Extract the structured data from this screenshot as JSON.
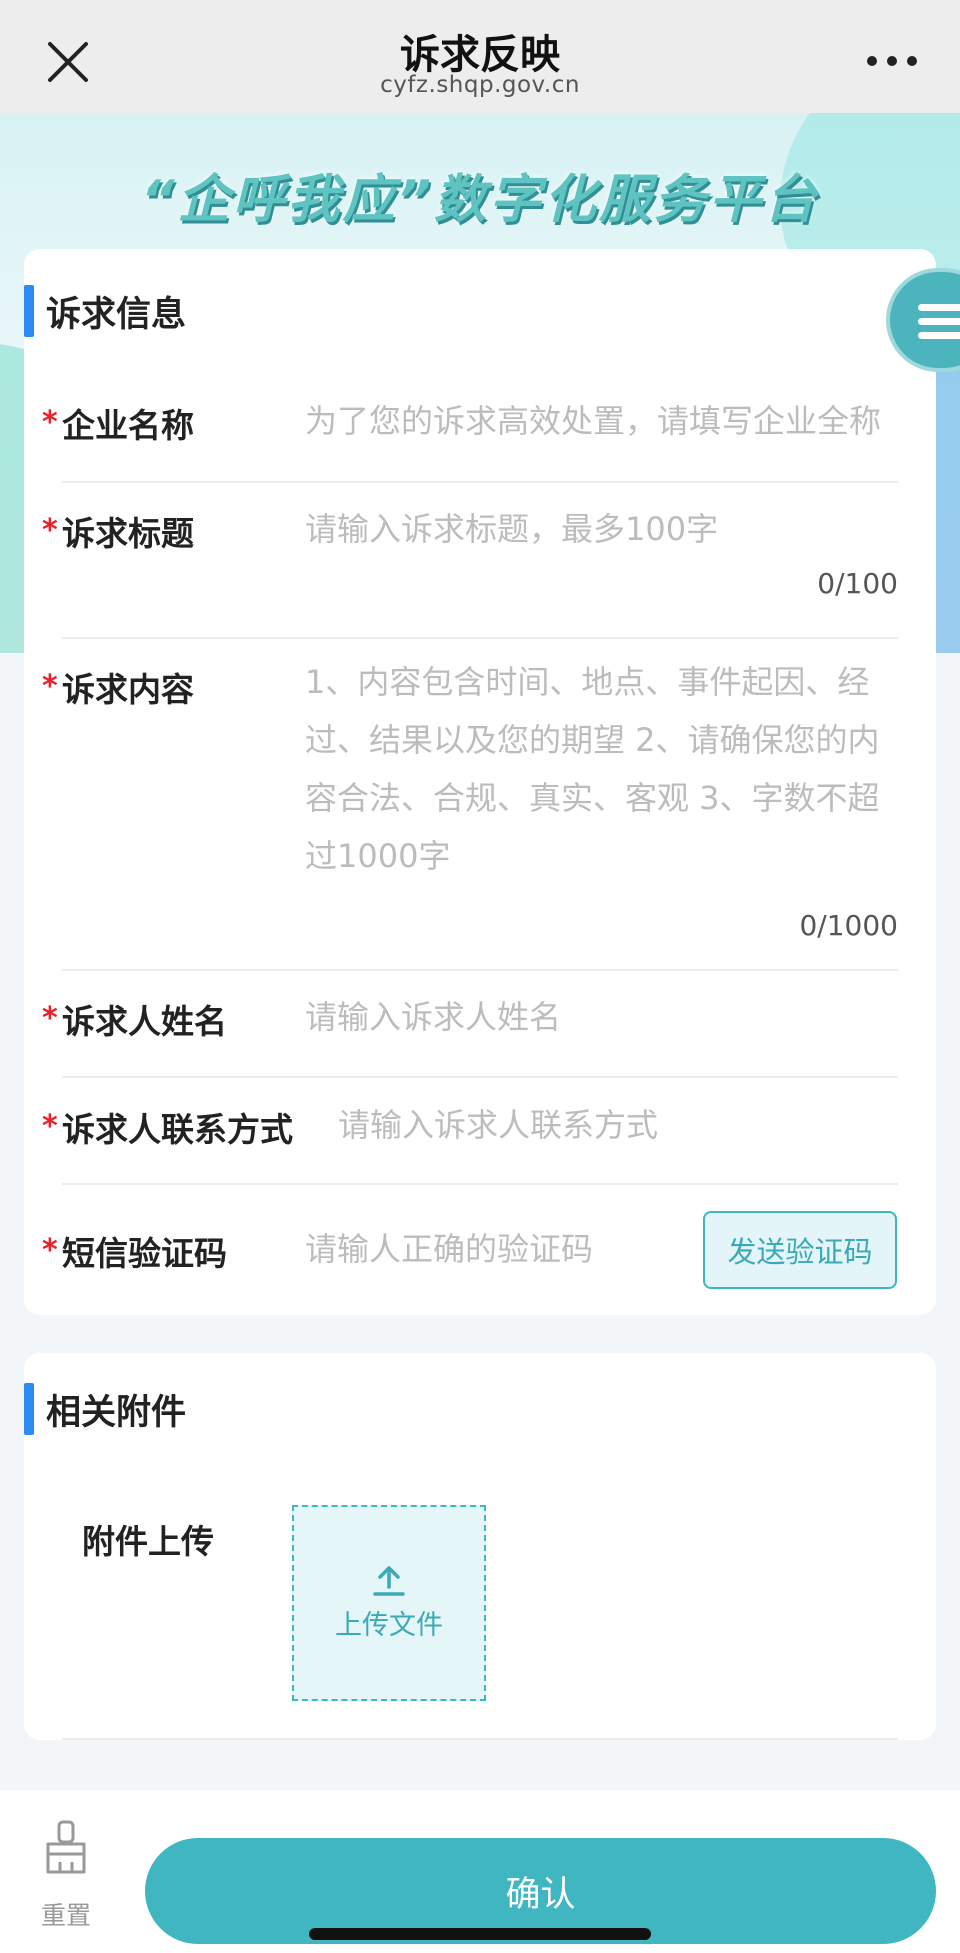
{
  "navbar": {
    "title": "诉求反映",
    "domain": "cyfz.shqp.gov.cn",
    "close_icon": "close-icon",
    "more_icon": "more-horizontal-icon"
  },
  "banner": {
    "title": "“企呼我应”数字化服务平台"
  },
  "info_section": {
    "title": "诉求信息",
    "fields": {
      "company": {
        "label": "企业名称",
        "placeholder": "为了您的诉求高效处置，请填写企业全称"
      },
      "title": {
        "label": "诉求标题",
        "placeholder": "请输入诉求标题，最多100字",
        "counter": "0/100"
      },
      "content": {
        "label": "诉求内容",
        "placeholder": "1、内容包含时间、地点、事件起因、经过、结果以及您的期望 2、请确保您的内容合法、合规、真实、客观 3、字数不超过1000字",
        "counter": "0/1000"
      },
      "name": {
        "label": "诉求人姓名",
        "placeholder": "请输入诉求人姓名"
      },
      "contact": {
        "label": "诉求人联系方式",
        "placeholder": "请输入诉求人联系方式"
      },
      "sms_code": {
        "label": "短信验证码",
        "placeholder": "请输人正确的验证码",
        "button": "发送验证码"
      }
    },
    "required_mark": "*"
  },
  "attach_section": {
    "title": "相关附件",
    "upload_label": "附件上传",
    "upload_button": "上传文件"
  },
  "bottom_bar": {
    "reset_label": "重置",
    "confirm_label": "确认"
  },
  "colors": {
    "accent": "#3fb6c0",
    "section_bar": "#2b8bf0",
    "required": "#e8212b"
  }
}
